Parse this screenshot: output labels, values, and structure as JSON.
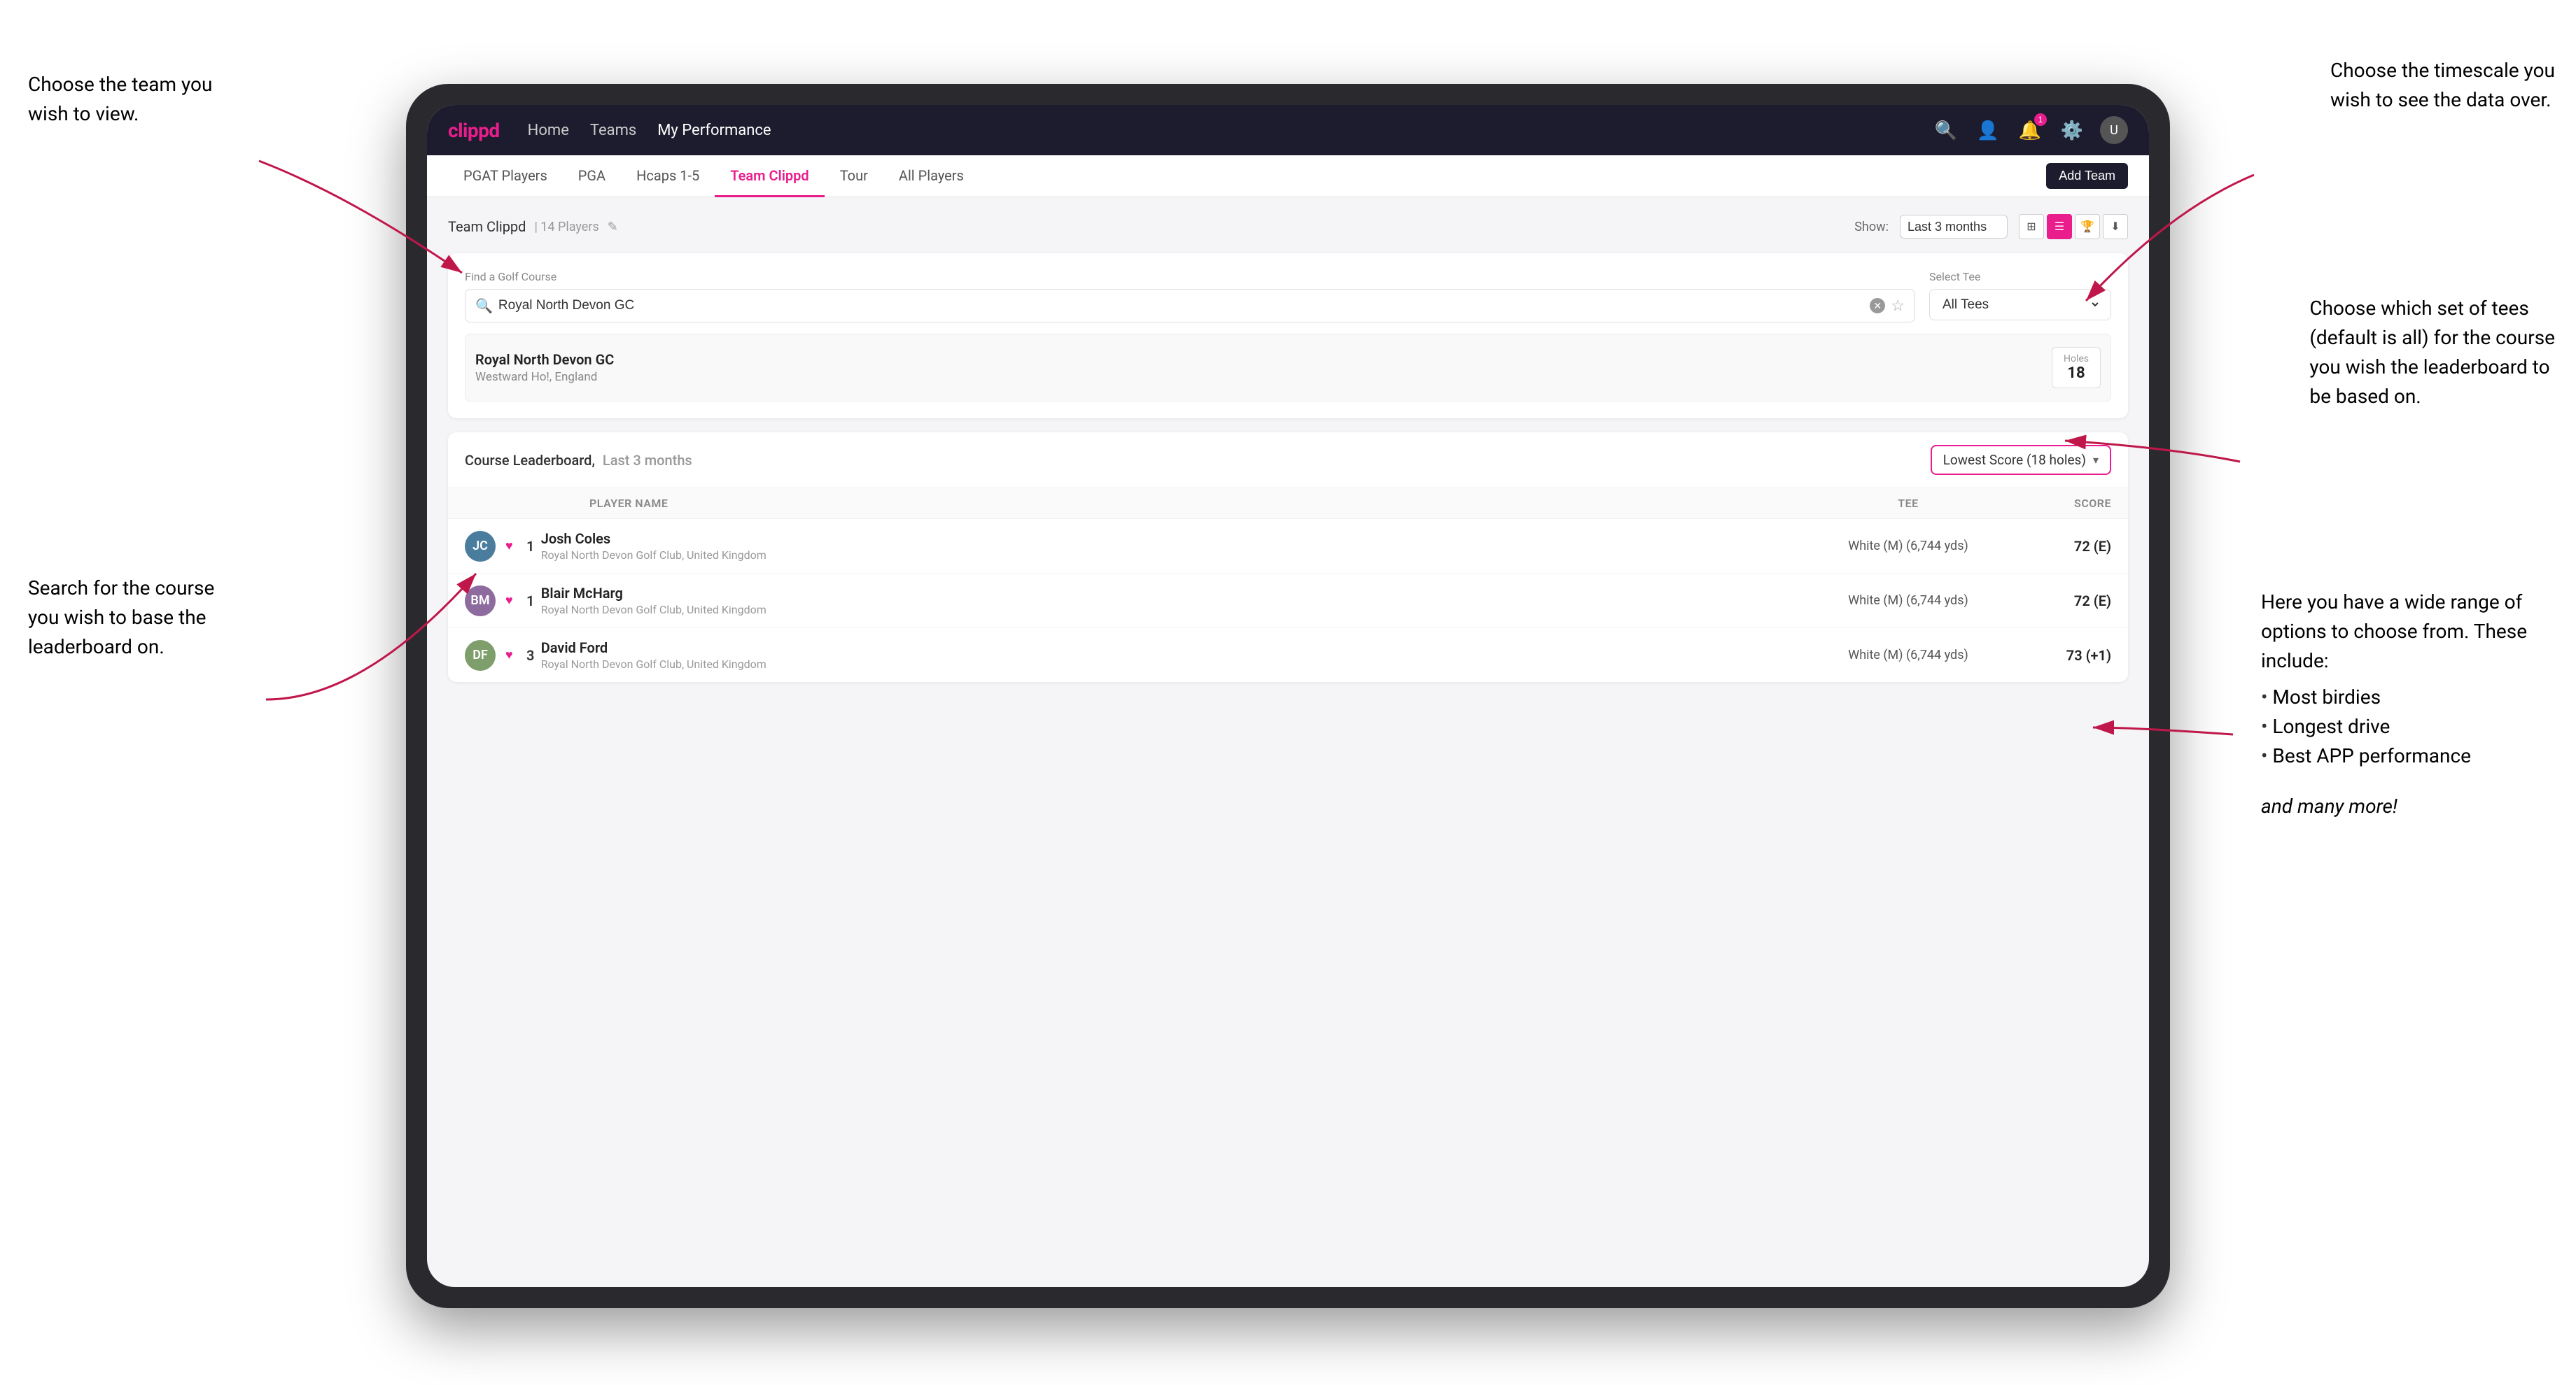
{
  "annotations": {
    "top_left": {
      "line1": "Choose the team you",
      "line2": "wish to view."
    },
    "bottom_left": {
      "line1": "Search for the course",
      "line2": "you wish to base the",
      "line3": "leaderboard on."
    },
    "top_right": {
      "line1": "Choose the timescale you",
      "line2": "wish to see the data over."
    },
    "mid_right": {
      "line1": "Choose which set of tees",
      "line2": "(default is all) for the course",
      "line3": "you wish the leaderboard to",
      "line4": "be based on."
    },
    "bottom_right": {
      "intro": "Here you have a wide range of options to choose from. These include:",
      "options": [
        "Most birdies",
        "Longest drive",
        "Best APP performance"
      ],
      "footer": "and many more!"
    }
  },
  "nav": {
    "logo": "clippd",
    "links": [
      "Home",
      "Teams",
      "My Performance"
    ],
    "active": "My Performance"
  },
  "sub_nav": {
    "links": [
      "PGAT Players",
      "PGA",
      "Hcaps 1-5",
      "Team Clippd",
      "Tour",
      "All Players"
    ],
    "active": "Team Clippd",
    "add_button": "Add Team"
  },
  "team_header": {
    "title": "Team Clippd",
    "player_count": "14 Players",
    "show_label": "Show:",
    "show_value": "Last 3 months",
    "view_modes": [
      "grid",
      "list",
      "trophy",
      "download"
    ]
  },
  "course_search": {
    "find_label": "Find a Golf Course",
    "find_placeholder": "Royal North Devon GC",
    "select_tee_label": "Select Tee",
    "select_tee_value": "All Tees"
  },
  "course_result": {
    "name": "Royal North Devon GC",
    "location": "Westward Ho!, England",
    "holes_label": "Holes",
    "holes_value": "18"
  },
  "leaderboard": {
    "title": "Course Leaderboard,",
    "subtitle": "Last 3 months",
    "score_type": "Lowest Score (18 holes)",
    "col_headers": [
      "PLAYER NAME",
      "TEE",
      "SCORE"
    ],
    "rows": [
      {
        "rank": "1",
        "name": "Josh Coles",
        "club": "Royal North Devon Golf Club, United Kingdom",
        "tee": "White (M) (6,744 yds)",
        "score": "72 (E)",
        "avatar_initials": "JC",
        "avatar_class": "avatar-jc"
      },
      {
        "rank": "1",
        "name": "Blair McHarg",
        "club": "Royal North Devon Golf Club, United Kingdom",
        "tee": "White (M) (6,744 yds)",
        "score": "72 (E)",
        "avatar_initials": "BM",
        "avatar_class": "avatar-bm"
      },
      {
        "rank": "3",
        "name": "David Ford",
        "club": "Royal North Devon Golf Club, United Kingdom",
        "tee": "White (M) (6,744 yds)",
        "score": "73 (+1)",
        "avatar_initials": "DF",
        "avatar_class": "avatar-df"
      }
    ]
  }
}
